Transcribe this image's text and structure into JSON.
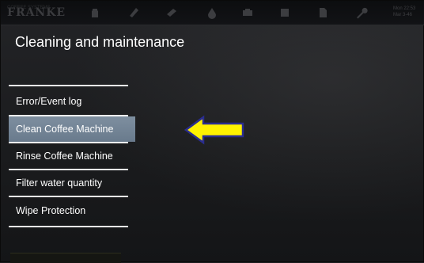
{
  "header": {
    "logo_text": "FRANKE",
    "logo_subtext": "COFFEE SYSTEMS",
    "clock_line1": "Mon 22:53",
    "clock_line2": "Mar 3-46",
    "nav_icons": [
      "product-icon",
      "cleaning-icon",
      "care-icon",
      "drop-icon",
      "milk-icon",
      "counter-icon",
      "document-icon",
      "wrench-icon"
    ]
  },
  "page": {
    "title": "Cleaning and maintenance"
  },
  "menu": {
    "items": [
      {
        "label": "Error/Event log"
      },
      {
        "label": "Clean Coffee Machine",
        "selected": true
      },
      {
        "label": "Rinse Coffee Machine"
      },
      {
        "label": "Filter water quantity"
      },
      {
        "label": "Wipe Protection"
      }
    ]
  },
  "colors": {
    "background": "#1d1e20",
    "selected_item": "#74879b",
    "arrow_fill": "#fff200",
    "arrow_outline": "#2a2d8f"
  }
}
